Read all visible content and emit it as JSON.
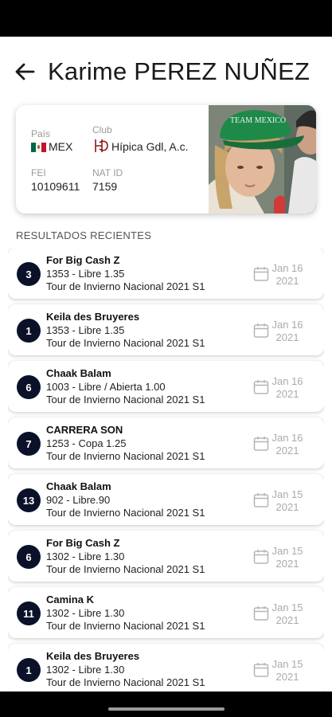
{
  "header": {
    "title": "Karime PEREZ NUÑEZ"
  },
  "profile": {
    "country_label": "País",
    "country_value": "MEX",
    "club_label": "Club",
    "club_value": "Hípica Gdl, A.c.",
    "fei_label": "FEI",
    "fei_value": "10109611",
    "natid_label": "NAT ID",
    "natid_value": "7159",
    "photo_cap_text": "TEAM MEXICO"
  },
  "results": {
    "heading": "RESULTADOS RECIENTES",
    "items": [
      {
        "rank": "3",
        "horse": "For Big Cash Z",
        "class": "1353 - Libre 1.35",
        "event": "Tour de Invierno Nacional  2021 S1",
        "date_day": "Jan 16",
        "date_year": "2021"
      },
      {
        "rank": "1",
        "horse": "Keila des Bruyeres",
        "class": "1353 - Libre 1.35",
        "event": "Tour de Invierno Nacional  2021 S1",
        "date_day": "Jan 16",
        "date_year": "2021"
      },
      {
        "rank": "6",
        "horse": "Chaak Balam",
        "class": "1003 - Libre / Abierta 1.00",
        "event": "Tour de Invierno Nacional  2021 S1",
        "date_day": "Jan 16",
        "date_year": "2021"
      },
      {
        "rank": "7",
        "horse": "CARRERA SON",
        "class": "1253 - Copa 1.25",
        "event": "Tour de Invierno Nacional  2021 S1",
        "date_day": "Jan 16",
        "date_year": "2021"
      },
      {
        "rank": "13",
        "horse": "Chaak Balam",
        "class": "902 - Libre.90",
        "event": "Tour de Invierno Nacional  2021 S1",
        "date_day": "Jan 15",
        "date_year": "2021"
      },
      {
        "rank": "6",
        "horse": "For Big Cash Z",
        "class": "1302 - Libre 1.30",
        "event": "Tour de Invierno Nacional  2021 S1",
        "date_day": "Jan 15",
        "date_year": "2021"
      },
      {
        "rank": "11",
        "horse": "Camina K",
        "class": "1302 - Libre 1.30",
        "event": "Tour de Invierno Nacional  2021 S1",
        "date_day": "Jan 15",
        "date_year": "2021"
      },
      {
        "rank": "1",
        "horse": "Keila des Bruyeres",
        "class": "1302 - Libre 1.30",
        "event": "Tour de Invierno Nacional  2021 S1",
        "date_day": "Jan 15",
        "date_year": "2021"
      }
    ]
  },
  "colors": {
    "badge": "#0b1128",
    "flag_green": "#006847",
    "flag_red": "#ce1126",
    "club_logo": "#8b1a1a",
    "cap_green": "#1e8a4a"
  },
  "icons": {
    "back": "back-arrow-icon",
    "flag": "mexico-flag-icon",
    "club": "club-logo-icon",
    "calendar": "calendar-icon"
  }
}
